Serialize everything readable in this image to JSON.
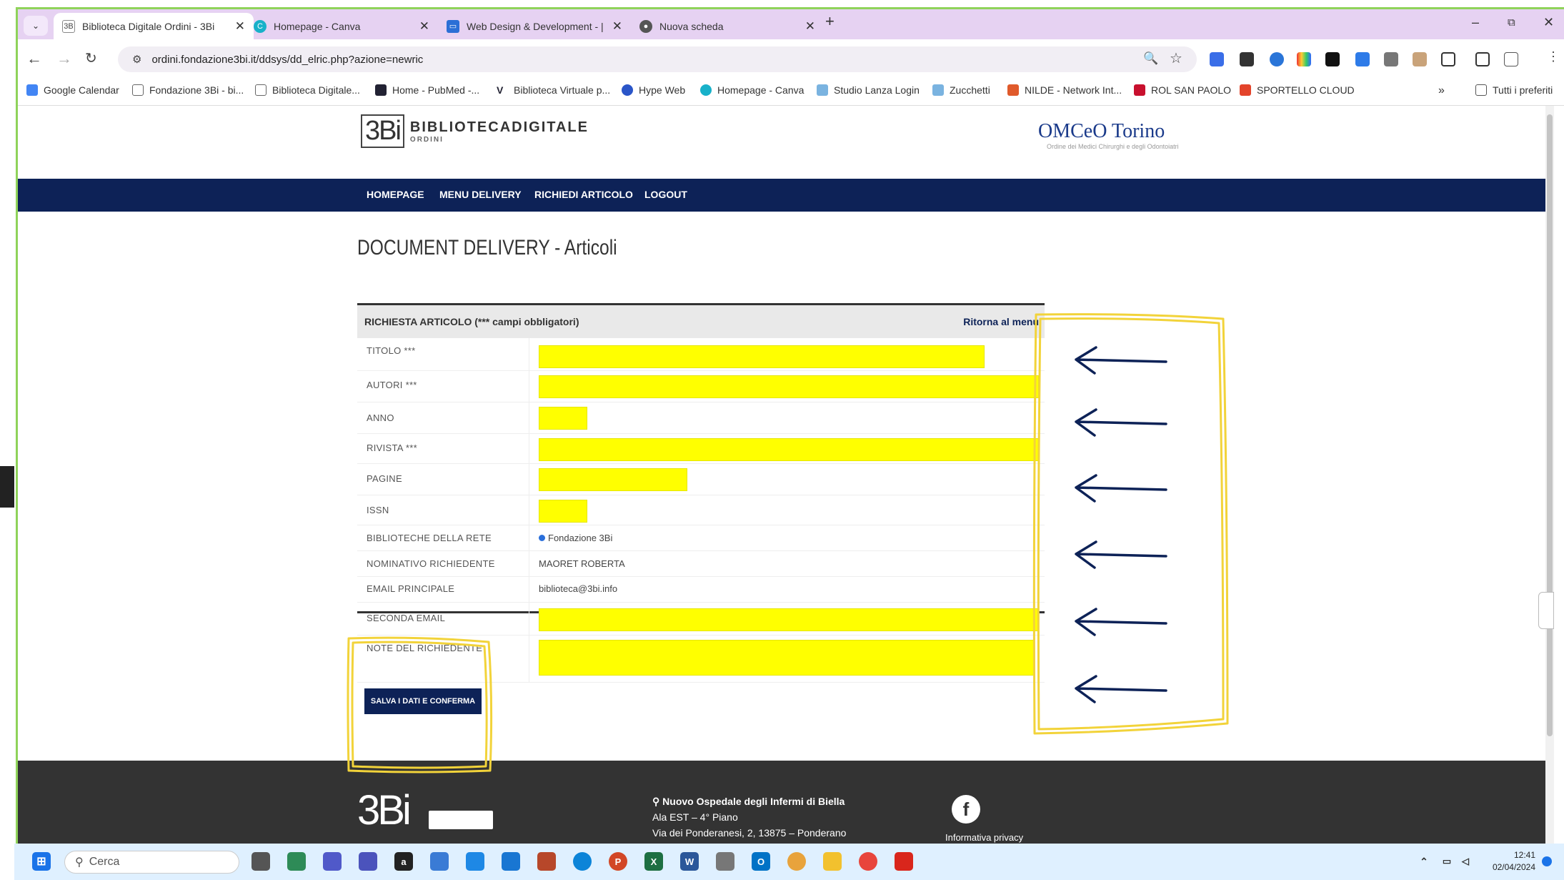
{
  "browser": {
    "tabs": [
      {
        "title": "Biblioteca Digitale Ordini - 3Bi",
        "active": true,
        "icon": "3bi-icon"
      },
      {
        "title": "Homepage - Canva",
        "active": false,
        "icon": "canva-icon"
      },
      {
        "title": "Web Design & Development - |",
        "active": false,
        "icon": "web-icon"
      },
      {
        "title": "Nuova scheda",
        "active": false,
        "icon": "chrome-icon"
      }
    ],
    "url": "ordini.fondazione3bi.it/ddsys/dd_elric.php?azione=newric",
    "bookmarks": [
      "Google Calendar",
      "Fondazione 3Bi - bi...",
      "Biblioteca Digitale...",
      "Home - PubMed -...",
      "Biblioteca Virtuale p...",
      "Hype Web",
      "Homepage - Canva",
      "Studio Lanza Login",
      "Zucchetti",
      "NILDE - Network Int...",
      "ROL SAN PAOLO",
      "SPORTELLO CLOUD"
    ],
    "all_bookmarks": "Tutti i preferiti"
  },
  "site": {
    "logo_mark": "3Bi",
    "logo_title": "BIBLIOTECADIGITALE",
    "logo_sub": "ORDINI",
    "partner_logo": "OMCeO Torino",
    "partner_sub": "Ordine dei Medici Chirurghi e degli Odontoiatri",
    "nav": [
      "HOMEPAGE",
      "MENU DELIVERY",
      "RICHIEDI ARTICOLO",
      "LOGOUT"
    ],
    "title": "DOCUMENT DELIVERY - Articoli"
  },
  "form": {
    "header": "RICHIESTA ARTICOLO (*** campi obbligatori)",
    "back_link": "Ritorna al menu",
    "fields": {
      "titolo": "TITOLO ***",
      "autori": "AUTORI ***",
      "anno": "ANNO",
      "rivista": "RIVISTA ***",
      "pagine": "PAGINE",
      "issn": "ISSN",
      "biblioteche": "BIBLIOTECHE DELLA RETE",
      "nominativo": "NOMINATIVO RICHIEDENTE",
      "email": "EMAIL PRINCIPALE",
      "seconda_email": "SECONDA EMAIL",
      "note": "NOTE DEL RICHIEDENTE"
    },
    "values": {
      "biblioteca": "Fondazione 3Bi",
      "nominativo": "MAORET ROBERTA",
      "email": "biblioteca@3bi.info"
    },
    "save_button": "SALVA I DATI E CONFERMA"
  },
  "footer": {
    "logo": "3Bi",
    "address_title": "Nuovo Ospedale degli Infermi di Biella",
    "address_line1": "Ala EST – 4° Piano",
    "address_line2": "Via dei Ponderanesi, 2, 13875 – Ponderano",
    "privacy": "Informativa privacy"
  },
  "taskbar": {
    "search_placeholder": "Cerca",
    "time": "12:41",
    "date": "02/04/2024"
  },
  "colors": {
    "nav": "#0d2257",
    "highlight": "#ffff00",
    "annotation": "#f2d33a",
    "arrow": "#0d2257"
  }
}
